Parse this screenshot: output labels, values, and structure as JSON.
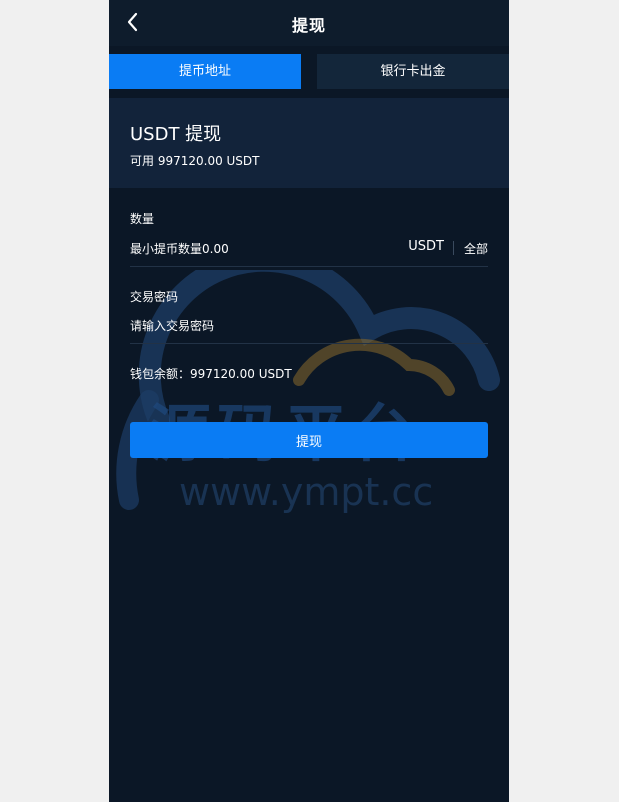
{
  "header": {
    "title": "提现"
  },
  "tabs": [
    {
      "label": "提币地址",
      "active": true
    },
    {
      "label": "银行卡出金",
      "active": false
    }
  ],
  "card": {
    "title": "USDT 提现",
    "available": "可用 997120.00 USDT"
  },
  "amount": {
    "label": "数量",
    "placeholder": "最小提币数量0.00",
    "unit": "USDT",
    "all_label": "全部"
  },
  "password": {
    "label": "交易密码",
    "placeholder": "请输入交易密码"
  },
  "balance": "钱包余额：997120.00 USDT",
  "submit_label": "提现",
  "watermark": {
    "text": "源码平台",
    "url": "www.ympt.cc"
  },
  "colors": {
    "accent": "#0a7cf4",
    "background": "#0b1726",
    "card": "#12233a"
  }
}
